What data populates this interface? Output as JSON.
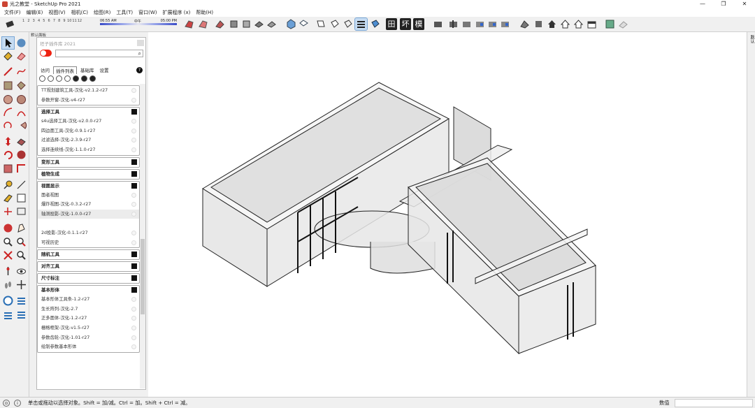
{
  "window": {
    "title": "光之教堂 - SketchUp Pro 2021",
    "min": "—",
    "max": "❐",
    "close": "✕"
  },
  "menu": [
    "文件(F)",
    "编辑(E)",
    "视图(V)",
    "相机(C)",
    "绘图(R)",
    "工具(T)",
    "窗口(W)",
    "扩展程序 (x)",
    "帮助(H)"
  ],
  "shadow": {
    "months": [
      "1",
      "2",
      "3",
      "4",
      "5",
      "6",
      "7",
      "8",
      "9",
      "10",
      "11",
      "12"
    ],
    "time_start": "06:55 AM",
    "time_mid": "中午",
    "time_end": "05:00 PM"
  },
  "toolbar_text": {
    "b1": "田",
    "b2": "坏",
    "b3": "模"
  },
  "tray": {
    "header": "默认面板"
  },
  "panel": {
    "title": "坯子插件库 2021",
    "search_placeholder": "",
    "tabs": [
      "访问",
      "插件列表",
      "基础库",
      "设置"
    ],
    "help": "?",
    "sections": [
      {
        "title": "",
        "toggle": false,
        "items": [
          "TT规划建筑工具-汉化-v2.1.2-r27",
          "参数开窗-汉化-v4-r27"
        ]
      },
      {
        "title": "选择工具",
        "items": [
          "s4u选择工具-汉化-v2.0.0-r27",
          "四边面工具-汉化-0.9.1-r27",
          "过滤选择-汉化-2.3.9-r27",
          "选择连续线-汉化-1.1.0-r27"
        ]
      },
      {
        "title": "变形工具",
        "items": []
      },
      {
        "title": "植物生成",
        "items": []
      },
      {
        "title": "视图显示",
        "items": [
          "面者视图",
          "爆炸视图-汉化-0.3.2-r27",
          "轴测投影-汉化-1.0.0-r27",
          "",
          "2d投影-汉化-0.1.1-r27",
          "可视历史"
        ]
      },
      {
        "title": "随机工具",
        "items": []
      },
      {
        "title": "对齐工具",
        "items": []
      },
      {
        "title": "尺寸标注",
        "items": []
      },
      {
        "title": "基本形体",
        "items": [
          "基本形体工具条-1.2-r27",
          "生长阵列-汉化-2.7",
          "正多面体-汉化-1.2-r27",
          "栅格框架-汉化-v1.5-r27",
          "参数齿轮-汉化-1.01-r27",
          "绘制参数基本形体"
        ]
      }
    ]
  },
  "right_panel_label": "默认",
  "status": {
    "message": "单击或拖动以选择对象。Shift = 加/减。Ctrl = 加。Shift + Ctrl = 减。",
    "value_label": "数值",
    "value": ""
  }
}
